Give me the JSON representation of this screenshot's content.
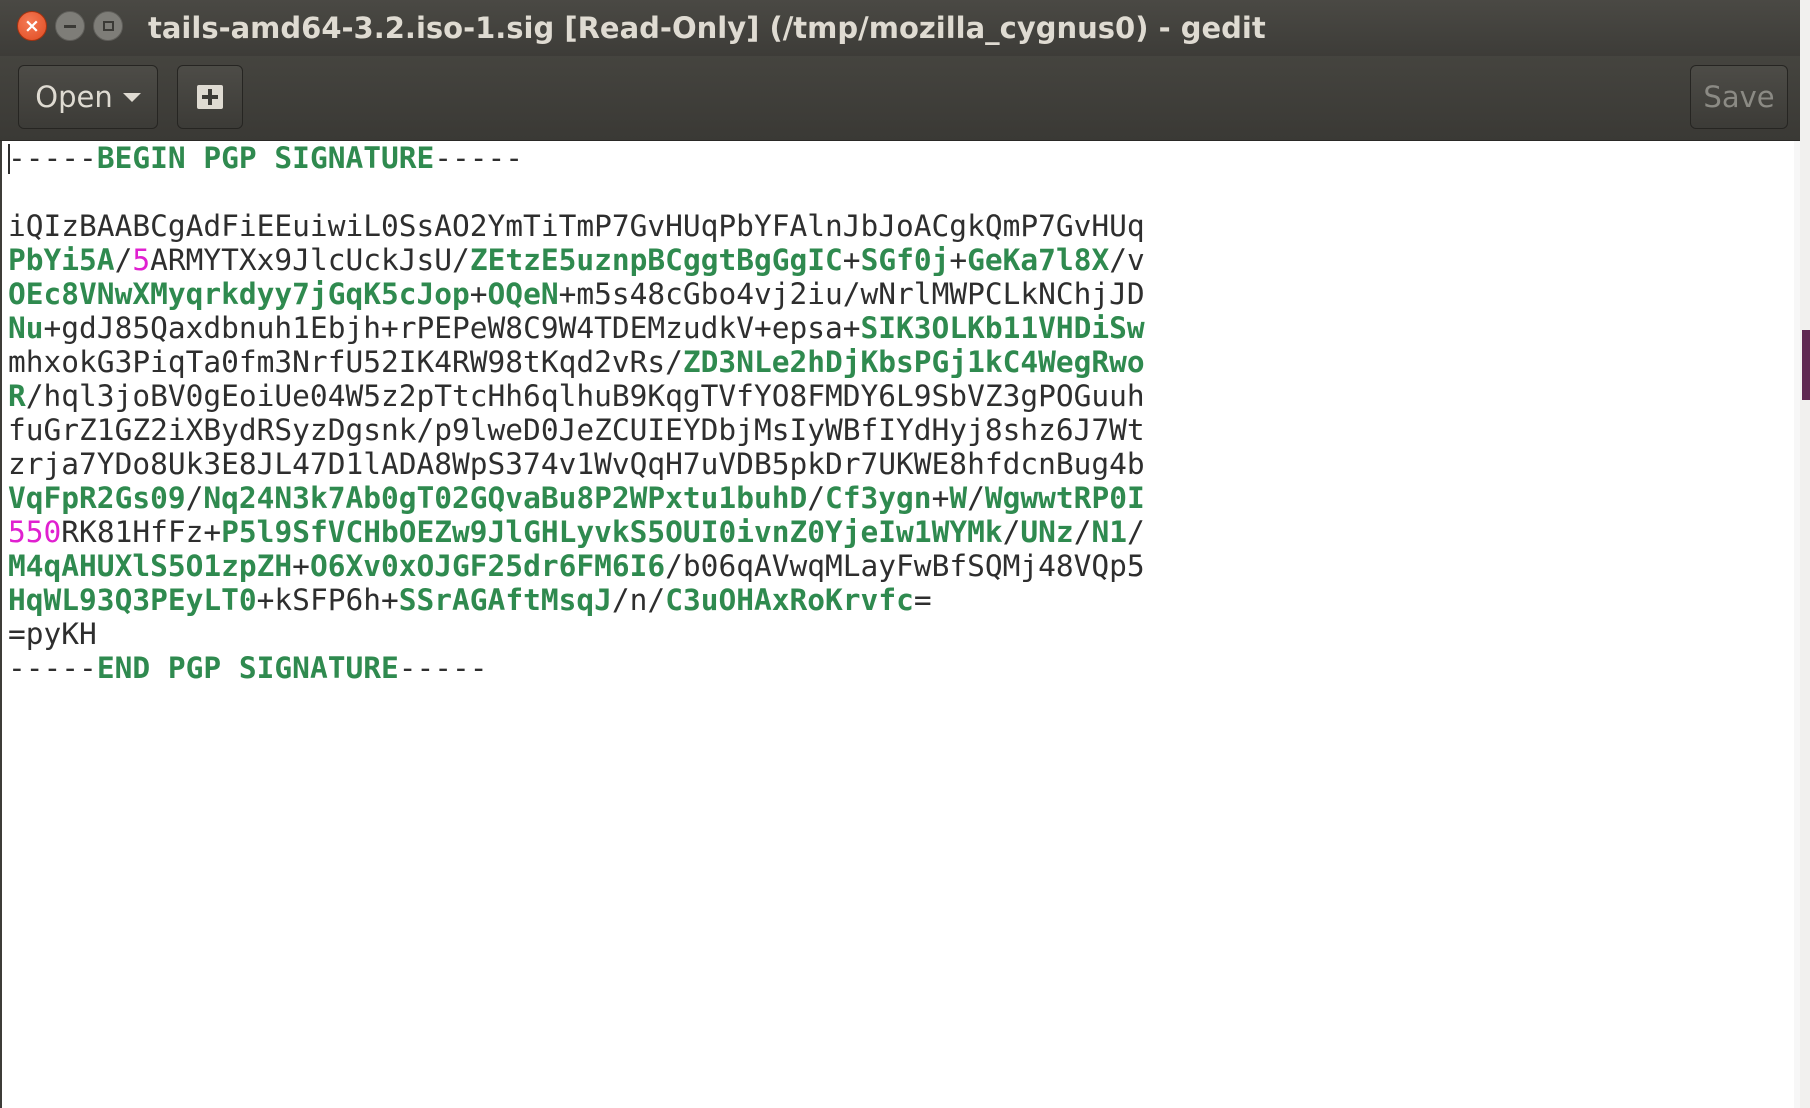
{
  "window": {
    "title": "tails-amd64-3.2.iso-1.sig [Read-Only] (/tmp/mozilla_cygnus0) - gedit",
    "close_glyph": "×",
    "minimize_glyph": "",
    "maximize_glyph": ""
  },
  "toolbar": {
    "open_label": "Open",
    "save_label": "Save"
  },
  "icons": {
    "open_dropdown": "chevron-down-icon",
    "new_tab": "new-document-icon"
  },
  "colors": {
    "keyword_green": "#2f8a4f",
    "number_magenta": "#e020d0",
    "close_orange": "#e04b21"
  },
  "document": {
    "lines": [
      [
        {
          "t": "-----",
          "s": "plain"
        },
        {
          "t": "BEGIN PGP SIGNATURE",
          "s": "g"
        },
        {
          "t": "-----",
          "s": "plain"
        }
      ],
      [],
      [
        {
          "t": "iQIzBAABCgAdFiEEuiwiL0SsAO2YmTiTmP7GvHUqPbYFAlnJbJoACgkQmP7GvHUq",
          "s": "plain"
        }
      ],
      [
        {
          "t": "PbYi5A",
          "s": "g"
        },
        {
          "t": "/",
          "s": "plain"
        },
        {
          "t": "5",
          "s": "m"
        },
        {
          "t": "ARMYTXx9JlcUckJsU/",
          "s": "plain"
        },
        {
          "t": "ZEtzE5uznpBCggtBgGgIC",
          "s": "g"
        },
        {
          "t": "+",
          "s": "plain"
        },
        {
          "t": "SGf0j",
          "s": "g"
        },
        {
          "t": "+",
          "s": "plain"
        },
        {
          "t": "GeKa7l8X",
          "s": "g"
        },
        {
          "t": "/v",
          "s": "plain"
        }
      ],
      [
        {
          "t": "OEc8VNwXMyqrkdyy7jGqK5cJop",
          "s": "g"
        },
        {
          "t": "+",
          "s": "plain"
        },
        {
          "t": "OQeN",
          "s": "g"
        },
        {
          "t": "+m5s48cGbo4vj2iu/wNrlMWPCLkNChjJD",
          "s": "plain"
        }
      ],
      [
        {
          "t": "Nu",
          "s": "g"
        },
        {
          "t": "+gdJ85Qaxdbnuh1Ebjh+rPEPeW8C9W4TDEMzudkV+epsa+",
          "s": "plain"
        },
        {
          "t": "SIK3OLKb11VHDiSw",
          "s": "g"
        }
      ],
      [
        {
          "t": "mhxokG3PiqTa0fm3NrfU52IK4RW98tKqd2vRs/",
          "s": "plain"
        },
        {
          "t": "ZD3NLe2hDjKbsPGj1kC4WegRwo",
          "s": "g"
        }
      ],
      [
        {
          "t": "R",
          "s": "g"
        },
        {
          "t": "/hql3joBV0gEoiUe04W5z2pTtcHh6qlhuB9KqgTVfYO8FMDY6L9SbVZ3gPOGuuh",
          "s": "plain"
        }
      ],
      [
        {
          "t": "fuGrZ1GZ2iXBydRSyzDgsnk/p9lweD0JeZCUIEYDbjMsIyWBfIYdHyj8shz6J7Wt",
          "s": "plain"
        }
      ],
      [
        {
          "t": "zrja7YDo8Uk3E8JL47D1lADA8WpS374v1WvQqH7uVDB5pkDr7UKWE8hfdcnBug4b",
          "s": "plain"
        }
      ],
      [
        {
          "t": "VqFpR2Gs09",
          "s": "g"
        },
        {
          "t": "/",
          "s": "plain"
        },
        {
          "t": "Nq24N3k7Ab0gT02GQvaBu8P2WPxtu1buhD",
          "s": "g"
        },
        {
          "t": "/",
          "s": "plain"
        },
        {
          "t": "Cf3ygn",
          "s": "g"
        },
        {
          "t": "+",
          "s": "plain"
        },
        {
          "t": "W",
          "s": "g"
        },
        {
          "t": "/",
          "s": "plain"
        },
        {
          "t": "WgwwtRP0I",
          "s": "g"
        }
      ],
      [
        {
          "t": "550",
          "s": "m"
        },
        {
          "t": "RK81HfFz+",
          "s": "plain"
        },
        {
          "t": "P5l9SfVCHbOEZw9JlGHLyvkS5OUI0ivnZ0YjeIw1WYMk",
          "s": "g"
        },
        {
          "t": "/",
          "s": "plain"
        },
        {
          "t": "UNz",
          "s": "g"
        },
        {
          "t": "/",
          "s": "plain"
        },
        {
          "t": "N1",
          "s": "g"
        },
        {
          "t": "/",
          "s": "plain"
        }
      ],
      [
        {
          "t": "M4qAHUXlS5O1zpZH",
          "s": "g"
        },
        {
          "t": "+",
          "s": "plain"
        },
        {
          "t": "O6Xv0xOJGF25dr6FM6I6",
          "s": "g"
        },
        {
          "t": "/b06qAVwqMLayFwBfSQMj48VQp5",
          "s": "plain"
        }
      ],
      [
        {
          "t": "HqWL93Q3PEyLT0",
          "s": "g"
        },
        {
          "t": "+kSFP6h+",
          "s": "plain"
        },
        {
          "t": "SSrAGAftMsqJ",
          "s": "g"
        },
        {
          "t": "/n/",
          "s": "plain"
        },
        {
          "t": "C3uOHAxRoKrvfc",
          "s": "g"
        },
        {
          "t": "=",
          "s": "plain"
        }
      ],
      [
        {
          "t": "=pyKH",
          "s": "plain"
        }
      ],
      [
        {
          "t": "-----",
          "s": "plain"
        },
        {
          "t": "END PGP SIGNATURE",
          "s": "g"
        },
        {
          "t": "-----",
          "s": "plain"
        }
      ]
    ]
  }
}
